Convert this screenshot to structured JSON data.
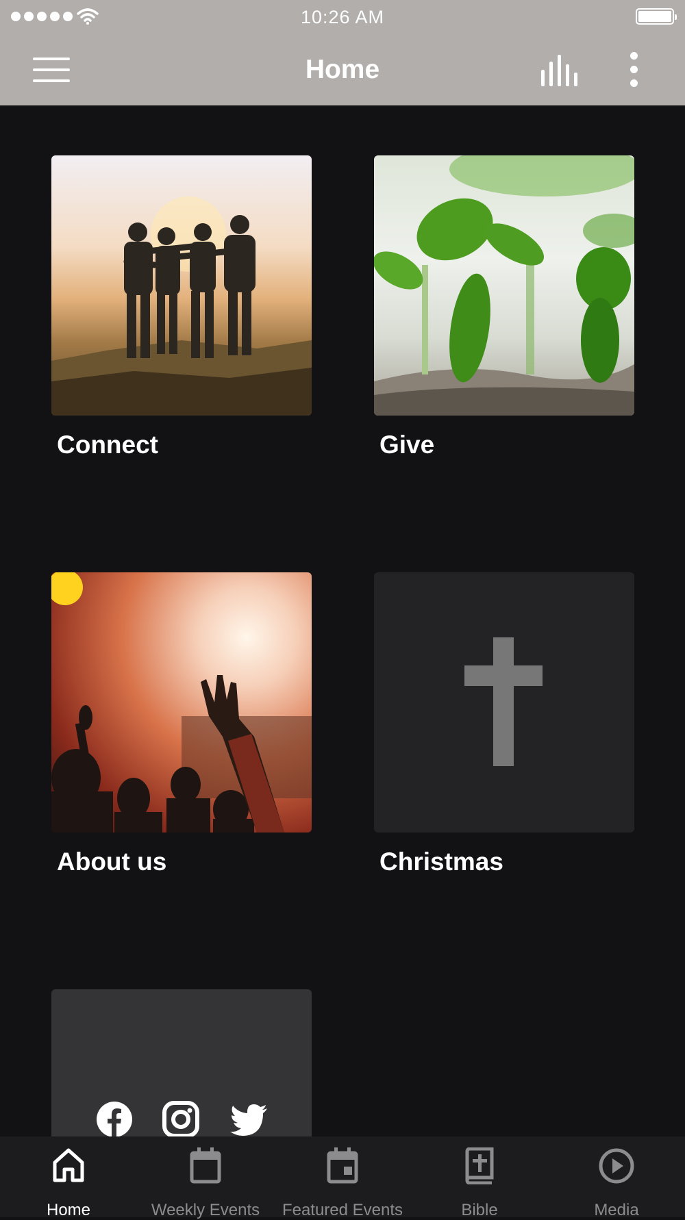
{
  "status_bar": {
    "time": "10:26 AM"
  },
  "header": {
    "title": "Home"
  },
  "tiles": [
    {
      "label": "Connect"
    },
    {
      "label": "Give"
    },
    {
      "label": "About us"
    },
    {
      "label": "Christmas"
    }
  ],
  "social": [
    "facebook-icon",
    "instagram-icon",
    "twitter-icon"
  ],
  "tab_bar": {
    "items": [
      {
        "label": "Home",
        "icon": "home-icon",
        "active": true
      },
      {
        "label": "Weekly Events",
        "icon": "calendar-icon"
      },
      {
        "label": "Featured Events",
        "icon": "calendar-event-icon"
      },
      {
        "label": "Bible",
        "icon": "bible-icon"
      },
      {
        "label": "Media",
        "icon": "play-circle-icon"
      }
    ]
  },
  "colors": {
    "header": "#b2aeac",
    "background": "#121214",
    "tab_bar": "#1c1c1e",
    "tab_inactive": "#8c8c8e",
    "cross": "#777777"
  }
}
